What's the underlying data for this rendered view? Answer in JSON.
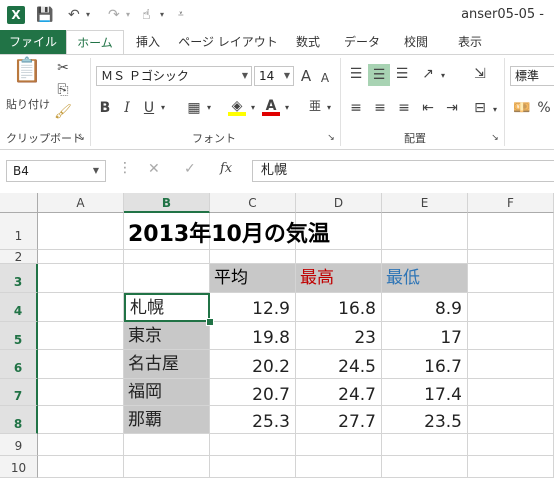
{
  "titlebar": {
    "app_icon": "X",
    "document_title": "anser05-05 - "
  },
  "tabs": {
    "file": "ファイル",
    "home": "ホーム",
    "insert": "挿入",
    "page_layout": "ページ レイアウト",
    "formulas": "数式",
    "data": "データ",
    "review": "校閲",
    "view": "表示"
  },
  "ribbon": {
    "clipboard": {
      "paste_label": "貼り付け",
      "group_label": "クリップボード"
    },
    "font": {
      "font_name": "ＭＳ Ｐゴシック",
      "font_size": "14",
      "group_label": "フォント",
      "grow": "A",
      "shrink": "A",
      "bold": "B",
      "italic": "I",
      "underline": "U",
      "font_color_letter": "A"
    },
    "alignment": {
      "group_label": "配置"
    },
    "number": {
      "format": "標準"
    }
  },
  "formula_bar": {
    "name_box": "B4",
    "fx": "fx",
    "content": "札幌"
  },
  "columns": [
    "A",
    "B",
    "C",
    "D",
    "E",
    "F"
  ],
  "rows": [
    "1",
    "2",
    "3",
    "4",
    "5",
    "6",
    "7",
    "8",
    "9",
    "10"
  ],
  "sheet": {
    "title": "2013年10月の気温",
    "headers": {
      "avg": "平均",
      "max": "最高",
      "min": "最低"
    },
    "cities": [
      "札幌",
      "東京",
      "名古屋",
      "福岡",
      "那覇"
    ],
    "avg": [
      "12.9",
      "19.8",
      "20.2",
      "20.7",
      "25.3"
    ],
    "max": [
      "16.8",
      "23",
      "24.5",
      "24.7",
      "27.7"
    ],
    "min": [
      "8.9",
      "17",
      "16.7",
      "17.4",
      "23.5"
    ]
  },
  "colors": {
    "accent": "#217346",
    "max_header": "#c00000",
    "min_header": "#2e75b6",
    "fill": "#c8c8c8"
  }
}
